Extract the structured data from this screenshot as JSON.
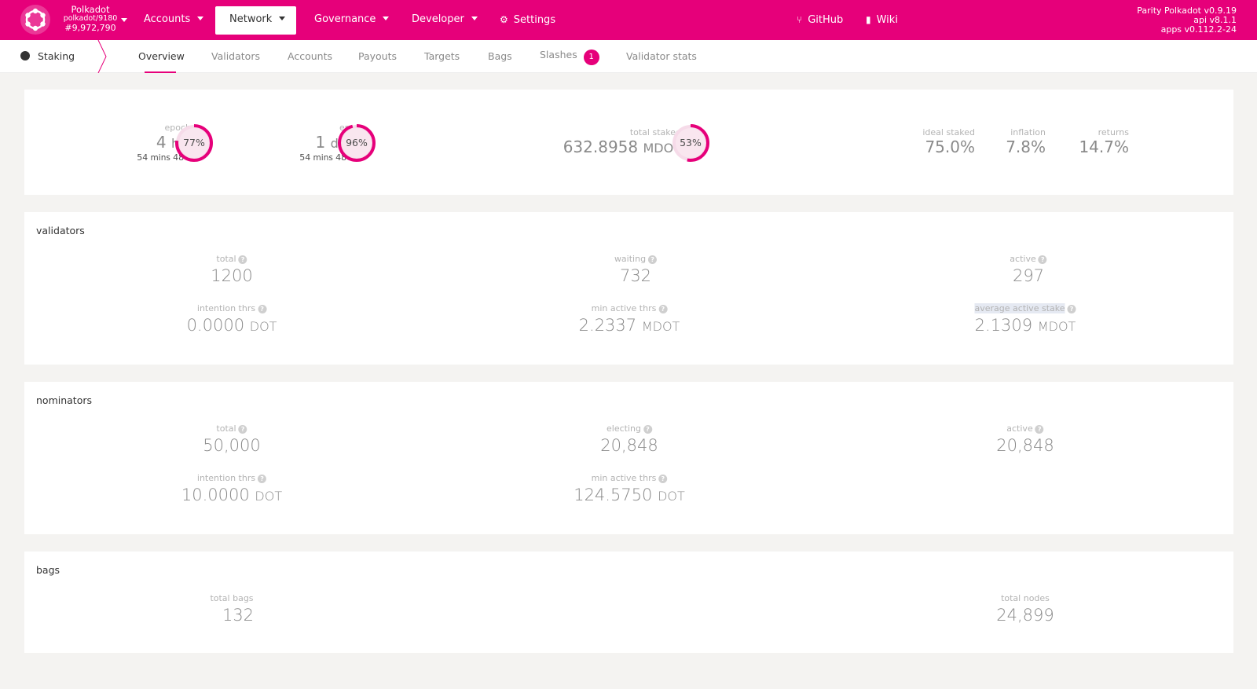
{
  "colors": {
    "accent": "#e6007a",
    "background": "#f4f3f1"
  },
  "header": {
    "chain": {
      "name": "Polkadot",
      "spec": "polkadot/9180",
      "block": "#9,972,790"
    },
    "menu": [
      {
        "label": "Accounts"
      },
      {
        "label": "Network"
      },
      {
        "label": "Governance"
      },
      {
        "label": "Developer"
      },
      {
        "label": "Settings",
        "icon": "gears-icon"
      }
    ],
    "links": [
      {
        "label": "GitHub",
        "icon": "branch-icon"
      },
      {
        "label": "Wiki",
        "icon": "book-icon"
      }
    ],
    "versions": {
      "node": "Parity Polkadot v0.9.19",
      "api": "api v8.1.1",
      "apps": "apps v0.112.2-24"
    }
  },
  "subnav": {
    "section": "Staking",
    "tabs": [
      "Overview",
      "Validators",
      "Accounts",
      "Payouts",
      "Targets",
      "Bags",
      "Slashes",
      "Validator stats"
    ],
    "active_tab": "Overview",
    "slashes_count": "1"
  },
  "summary": {
    "epoch": {
      "label": "epoch",
      "value": "4",
      "unit": "hrs",
      "mins": "54",
      "mins_unit": "mins",
      "secs": "48",
      "secs_unit": "s",
      "progress": 0.77,
      "progress_label": "77%"
    },
    "era": {
      "label": "era",
      "value": "1",
      "unit": "day",
      "mins": "54",
      "mins_unit": "mins",
      "secs": "48",
      "secs_unit": "s",
      "progress": 0.96,
      "progress_label": "96%"
    },
    "total_staked": {
      "label": "total staked",
      "value": "632.8958",
      "unit": "MDOT",
      "progress": 0.53,
      "progress_label": "53%"
    },
    "ideal_staked": {
      "label": "ideal staked",
      "value": "75.0%"
    },
    "inflation": {
      "label": "inflation",
      "value": "7.8%"
    },
    "returns": {
      "label": "returns",
      "value": "14.7%"
    }
  },
  "validators": {
    "title": "validators",
    "total": {
      "label": "total",
      "value": "1200"
    },
    "waiting": {
      "label": "waiting",
      "value": "732"
    },
    "active": {
      "label": "active",
      "value": "297"
    },
    "intention_thrs": {
      "label": "intention thrs",
      "value": "0.0000",
      "unit": "DOT"
    },
    "min_active_thrs": {
      "label": "min active thrs",
      "value": "2.2337",
      "unit": "MDOT"
    },
    "average_active_stake": {
      "label": "average active stake",
      "value": "2.1309",
      "unit": "MDOT"
    }
  },
  "nominators": {
    "title": "nominators",
    "total": {
      "label": "total",
      "value": "50,000"
    },
    "electing": {
      "label": "electing",
      "value": "20,848"
    },
    "active": {
      "label": "active",
      "value": "20,848"
    },
    "intention_thrs": {
      "label": "intention thrs",
      "value": "10.0000",
      "unit": "DOT"
    },
    "min_active_thrs": {
      "label": "min active thrs",
      "value": "124.5750",
      "unit": "DOT"
    }
  },
  "bags": {
    "title": "bags",
    "total_bags": {
      "label": "total bags",
      "value": "132"
    },
    "total_nodes": {
      "label": "total nodes",
      "value": "24,899"
    }
  }
}
